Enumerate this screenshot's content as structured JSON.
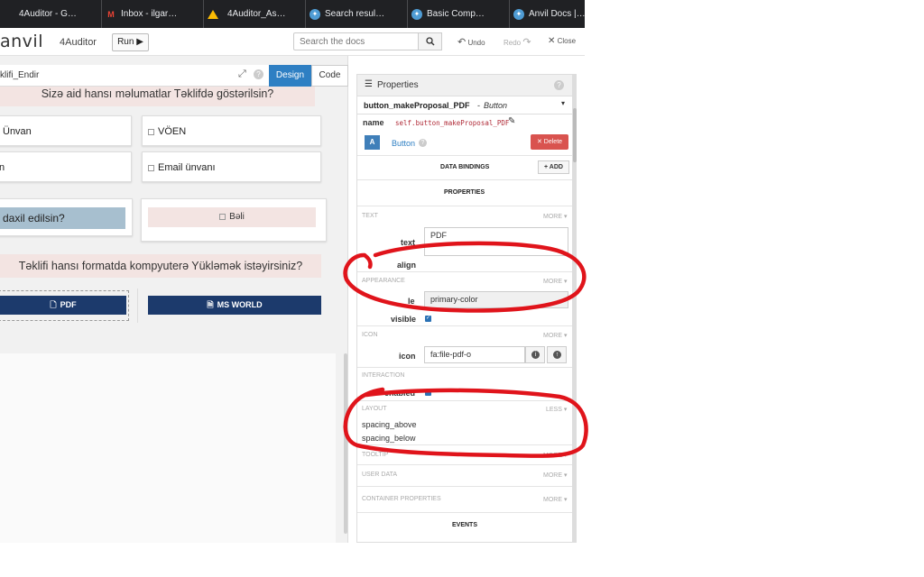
{
  "browser": {
    "tabs": [
      {
        "title": "4Auditor - G…",
        "icon": "none"
      },
      {
        "title": "Inbox - ilgar…",
        "icon": "gmail"
      },
      {
        "title": "4Auditor_As…",
        "icon": "drive"
      },
      {
        "title": "Search resul…",
        "icon": "anvil"
      },
      {
        "title": "Basic Comp…",
        "icon": "anvil"
      },
      {
        "title": "Anvil Docs |…",
        "icon": "anvil"
      }
    ]
  },
  "toolbar": {
    "logo": "anvil",
    "app_name": "4Auditor",
    "run_label": "Run ▶",
    "search_placeholder": "Search the docs",
    "undo_label": "Undo",
    "redo_label": "Redo",
    "close_label": "Close"
  },
  "form": {
    "title": "klifi_Endir",
    "design_tab": "Design",
    "code_tab": "Code",
    "question1": "Sizə aid hansı məlumatlar Təklifdə göstərilsin?",
    "checkbox_unvan": "Ünvan",
    "checkbox_voen": "VÖEN",
    "checkbox_partial": "n",
    "checkbox_email": "Email ünvanı",
    "question2_partial": "daxil edilsin?",
    "checkbox_beli": "Bəli",
    "question3": "Təklifi hansı formatda kompyuterə Yükləmək istəyirsiniz?",
    "pdf_button": "PDF",
    "msworld_button": "MS WORLD"
  },
  "properties": {
    "header": "Properties",
    "component_name": "button_makeProposal_PDF",
    "component_type": "Button",
    "name_label": "name",
    "name_value": "self.button_makeProposal_PDF",
    "component_class": "Button",
    "delete_label": "Delete",
    "data_bindings": "DATA BINDINGS",
    "add_label": "ADD",
    "properties_title": "PROPERTIES",
    "sections": {
      "text": "TEXT",
      "appearance": "APPEARANCE",
      "icon": "ICON",
      "interaction": "INTERACTION",
      "layout": "LAYOUT",
      "tooltip": "TOOLTIP",
      "user_data": "USER DATA",
      "container": "CONTAINER PROPERTIES"
    },
    "more": "MORE",
    "less": "LESS",
    "fields": {
      "text_label": "text",
      "text_value": "PDF",
      "align_label": "align",
      "role_label_partial": "le",
      "role_value": "primary-color",
      "visible_label": "visible",
      "visible_checked": true,
      "icon_label": "icon",
      "icon_value": "fa:file-pdf-o",
      "enabled_label": "enabled",
      "enabled_checked": true,
      "spacing_above": "spacing_above",
      "spacing_below": "spacing_below"
    },
    "events_title": "EVENTS"
  },
  "colors": {
    "accent_blue": "#2e7fc3",
    "navy_button": "#1c3a6c",
    "delete_red": "#d9534f",
    "annotation_red": "#e0141b",
    "question_pink": "#f3e4e2",
    "question_blue": "#a7bfcf"
  }
}
